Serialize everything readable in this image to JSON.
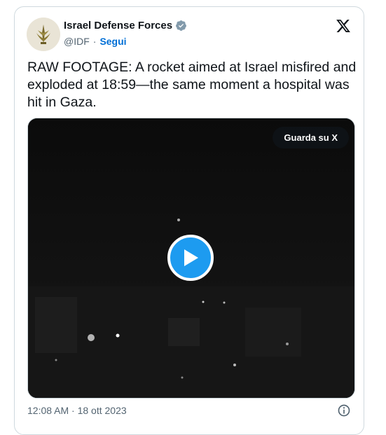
{
  "author": {
    "name": "Israel Defense Forces",
    "handle": "@IDF",
    "separator": "·",
    "follow_label": "Segui"
  },
  "tweet": {
    "text": "RAW FOOTAGE: A rocket aimed at Israel misfired and exploded at 18:59—the same moment a hospital was hit in Gaza."
  },
  "media": {
    "watch_label": "Guarda su X"
  },
  "footer": {
    "timestamp": "12:08 AM · 18 ott 2023"
  },
  "colors": {
    "accent": "#1d9bf0",
    "link": "#006fd6",
    "muted": "#536471"
  }
}
